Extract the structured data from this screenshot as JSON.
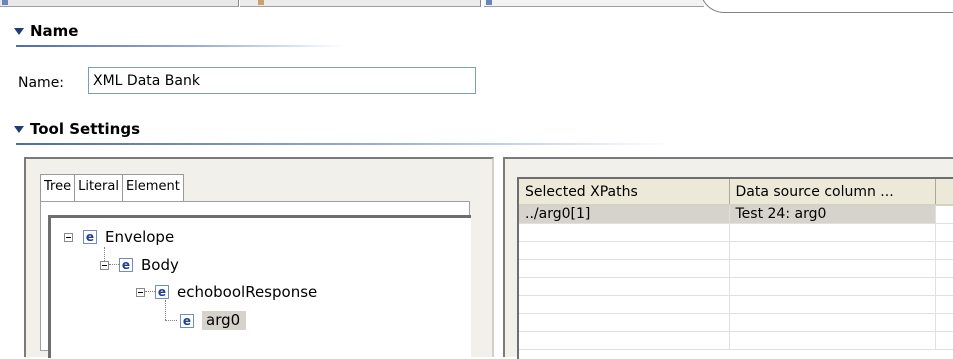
{
  "name_section": {
    "title": "Name",
    "label": "Name:",
    "value": "XML Data Bank"
  },
  "tool_settings": {
    "title": "Tool Settings",
    "tabs": [
      "Tree",
      "Literal",
      "Element"
    ],
    "active_tab": "Tree",
    "tree": [
      {
        "label": "Envelope",
        "icon": "e",
        "level": 0
      },
      {
        "label": "Body",
        "icon": "e",
        "level": 1
      },
      {
        "label": "echoboolResponse",
        "icon": "e",
        "level": 2
      },
      {
        "label": "arg0",
        "icon": "e",
        "level": 3,
        "selected": true
      }
    ]
  },
  "xpaths_table": {
    "headers": [
      "Selected XPaths",
      "Data source column ..."
    ],
    "rows": [
      {
        "xpath": "../arg0[1]",
        "column": "Test 24: arg0",
        "selected": true
      }
    ]
  },
  "colors": {
    "section_title": "#000000",
    "twisty": "#1f3a78",
    "selection": "#d6d3cc",
    "header_bg": "#ece9d8"
  }
}
